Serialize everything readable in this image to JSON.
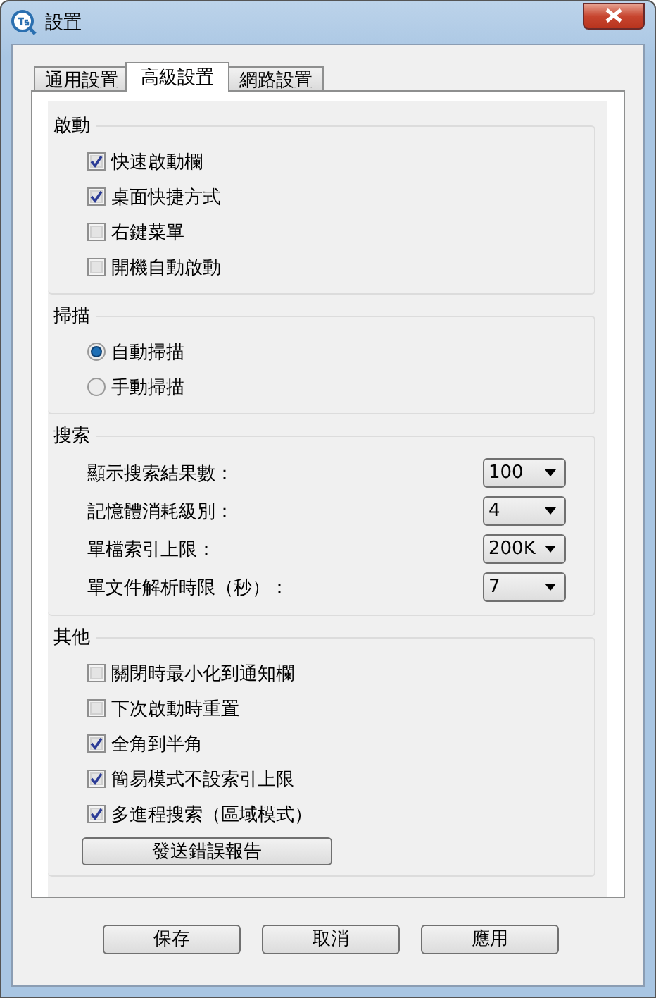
{
  "window": {
    "title": "設置"
  },
  "tabs": [
    {
      "label": "通用設置",
      "selected": false
    },
    {
      "label": "高級設置",
      "selected": true
    },
    {
      "label": "網路設置",
      "selected": false
    }
  ],
  "groups": [
    {
      "title": "啟動",
      "items": [
        {
          "kind": "checkbox",
          "label": "快速啟動欄",
          "checked": true
        },
        {
          "kind": "checkbox",
          "label": "桌面快捷方式",
          "checked": true
        },
        {
          "kind": "checkbox",
          "label": "右鍵菜單",
          "checked": false
        },
        {
          "kind": "checkbox",
          "label": "開機自動啟動",
          "checked": false
        }
      ]
    },
    {
      "title": "掃描",
      "items": [
        {
          "kind": "radio",
          "label": "自動掃描",
          "selected": true
        },
        {
          "kind": "radio",
          "label": "手動掃描",
          "selected": false
        }
      ]
    },
    {
      "title": "搜索",
      "items": [
        {
          "kind": "dropdown",
          "label": "顯示搜索結果數：",
          "value": "100"
        },
        {
          "kind": "dropdown",
          "label": "記憶體消耗級別：",
          "value": "4"
        },
        {
          "kind": "dropdown",
          "label": "單檔索引上限：",
          "value": "200K"
        },
        {
          "kind": "dropdown",
          "label": "單文件解析時限（秒）：",
          "value": "7"
        }
      ]
    },
    {
      "title": "其他",
      "items": [
        {
          "kind": "checkbox",
          "label": "關閉時最小化到通知欄",
          "checked": false
        },
        {
          "kind": "checkbox",
          "label": "下次啟動時重置",
          "checked": false
        },
        {
          "kind": "checkbox",
          "label": "全角到半角",
          "checked": true
        },
        {
          "kind": "checkbox",
          "label": "簡易模式不設索引上限",
          "checked": true
        },
        {
          "kind": "checkbox",
          "label": "多進程搜索（區域模式）",
          "checked": true
        },
        {
          "kind": "button",
          "label": "發送錯誤報告"
        }
      ]
    }
  ],
  "buttons": [
    "保存",
    "取消",
    "應用"
  ]
}
